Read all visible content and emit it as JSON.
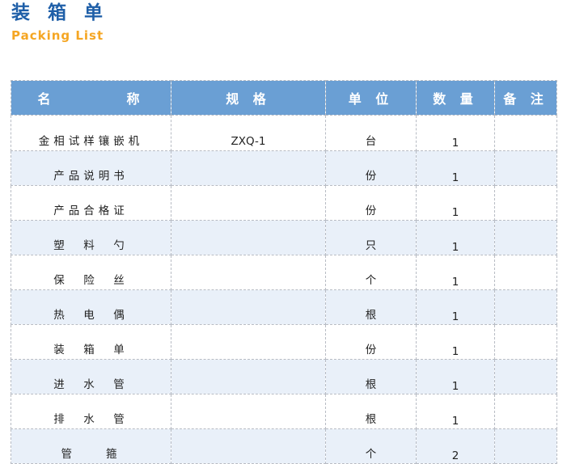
{
  "header": {
    "title_zh": "装 箱 单",
    "title_en": "Packing List"
  },
  "table": {
    "columns": [
      "名　　　　称",
      "规 格",
      "单 位",
      "数 量",
      "备 注"
    ],
    "rows": [
      {
        "name": "金相试样镶嵌机",
        "spec": "ZXQ-1",
        "unit": "台",
        "qty": "1",
        "note": ""
      },
      {
        "name": "产品说明书",
        "spec": "",
        "unit": "份",
        "qty": "1",
        "note": ""
      },
      {
        "name": "产品合格证",
        "spec": "",
        "unit": "份",
        "qty": "1",
        "note": ""
      },
      {
        "name": "塑　料　勺",
        "spec": "",
        "unit": "只",
        "qty": "1",
        "note": ""
      },
      {
        "name": "保　险　丝",
        "spec": "",
        "unit": "个",
        "qty": "1",
        "note": ""
      },
      {
        "name": "热　电　偶",
        "spec": "",
        "unit": "根",
        "qty": "1",
        "note": ""
      },
      {
        "name": "装　箱　单",
        "spec": "",
        "unit": "份",
        "qty": "1",
        "note": ""
      },
      {
        "name": "进　水　管",
        "spec": "",
        "unit": "根",
        "qty": "1",
        "note": ""
      },
      {
        "name": "排　水　管",
        "spec": "",
        "unit": "根",
        "qty": "1",
        "note": ""
      },
      {
        "name": "管　　箍",
        "spec": "",
        "unit": "个",
        "qty": "2",
        "note": ""
      }
    ]
  }
}
